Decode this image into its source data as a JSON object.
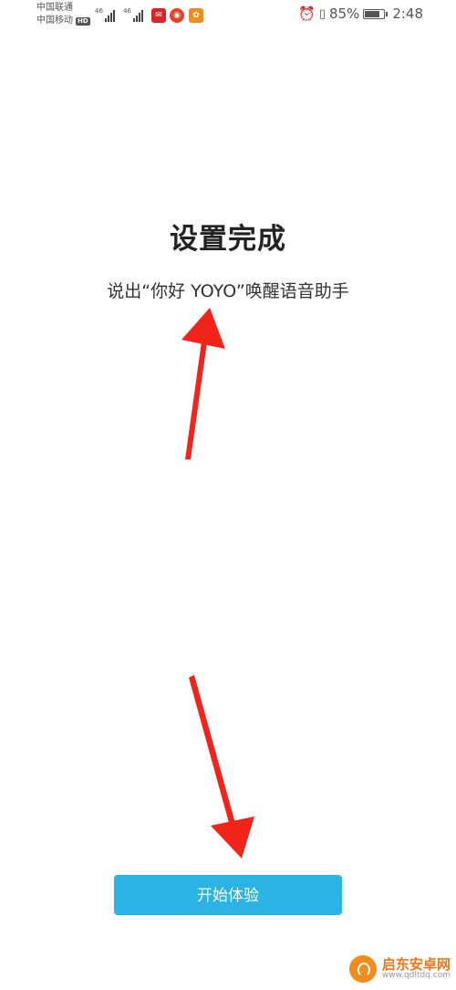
{
  "status_bar": {
    "carrier1": "中国联通",
    "carrier2": "中国移动",
    "hd_badge": "HD",
    "signal1_tag": "46",
    "signal2_tag": "46",
    "battery_level": "85%",
    "battery_fraction": 0.85,
    "time": "2:48"
  },
  "page": {
    "title": "设置完成",
    "subtitle": "说出“你好 YOYO”唤醒语音助手"
  },
  "actions": {
    "start_label": "开始体验"
  },
  "watermark": {
    "name": "启东安卓网",
    "url": "www.qdltdq.com"
  },
  "colors": {
    "button": "#2bb3e3",
    "annotation_arrow": "#f0241b",
    "watermark_orange": "#e9771a"
  }
}
